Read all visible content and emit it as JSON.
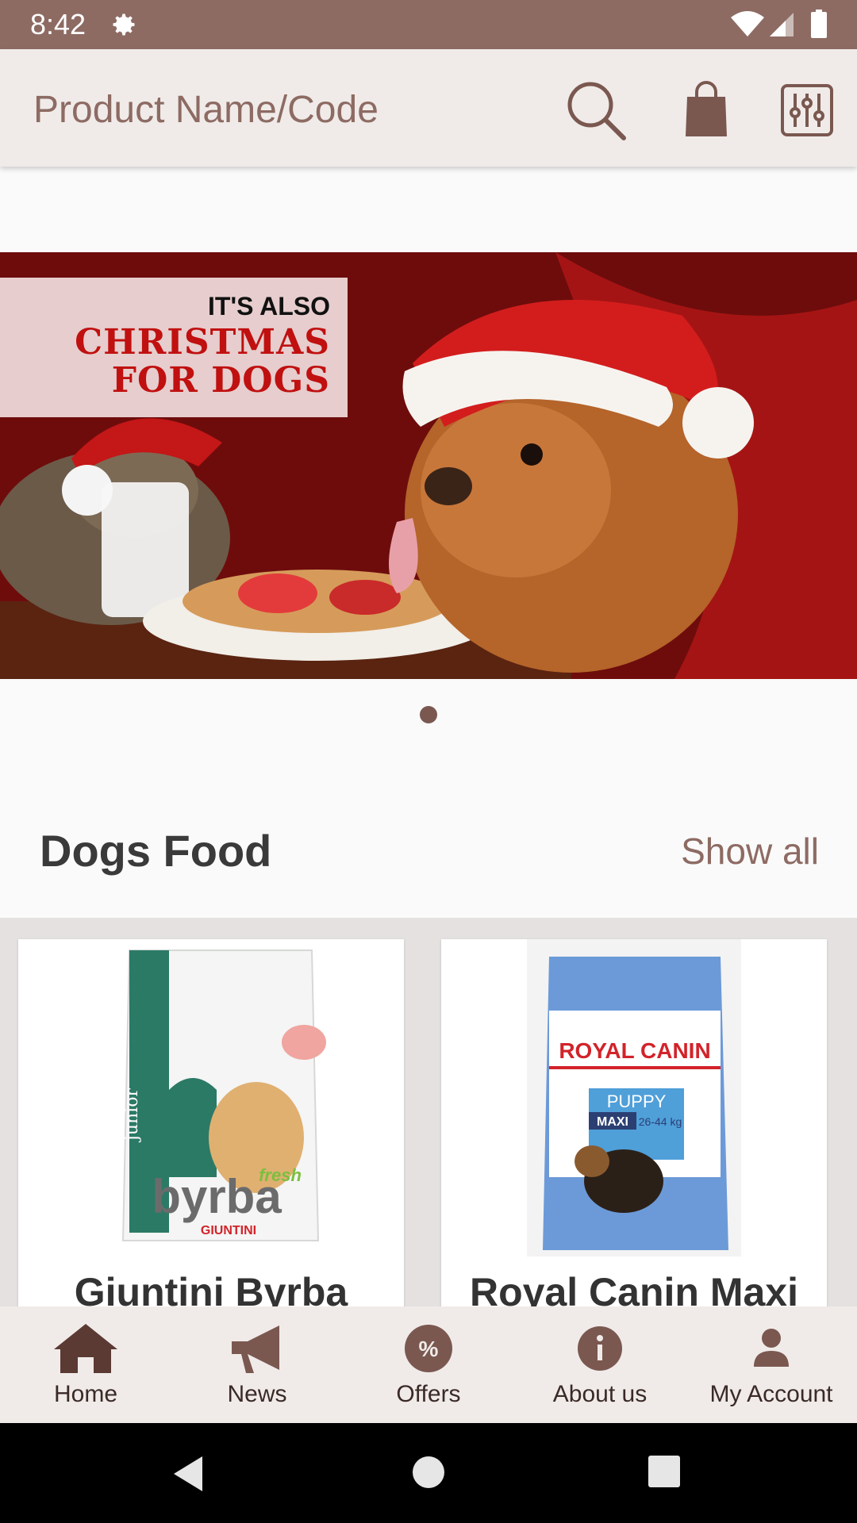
{
  "status_bar": {
    "time": "8:42"
  },
  "search": {
    "placeholder": "Product Name/Code"
  },
  "banner": {
    "line1": "IT'S ALSO",
    "line2a": "CHRISTMAS",
    "line2b": "FOR DOGS"
  },
  "section": {
    "title": "Dogs Food",
    "show_all": "Show all"
  },
  "products": [
    {
      "name": "Giuntini Byrba",
      "brand_text": "byrba",
      "maker_text": "GIUNTINI",
      "tag_text": "junior",
      "fresh_text": "fresh"
    },
    {
      "name": "Royal Canin Maxi",
      "brand_text": "ROYAL CANIN",
      "line_text": "PUPPY",
      "size_text": "MAXI",
      "weight_text": "26-44 kg"
    }
  ],
  "bottom_nav": {
    "items": [
      {
        "label": "Home",
        "icon": "home-icon"
      },
      {
        "label": "News",
        "icon": "megaphone-icon"
      },
      {
        "label": "Offers",
        "icon": "percent-badge-icon"
      },
      {
        "label": "About us",
        "icon": "info-icon"
      },
      {
        "label": "My Account",
        "icon": "person-icon"
      }
    ]
  },
  "colors": {
    "accent": "#8d6b63",
    "bar_bg": "#f0ebe9",
    "nav_icon": "#7a5850"
  }
}
